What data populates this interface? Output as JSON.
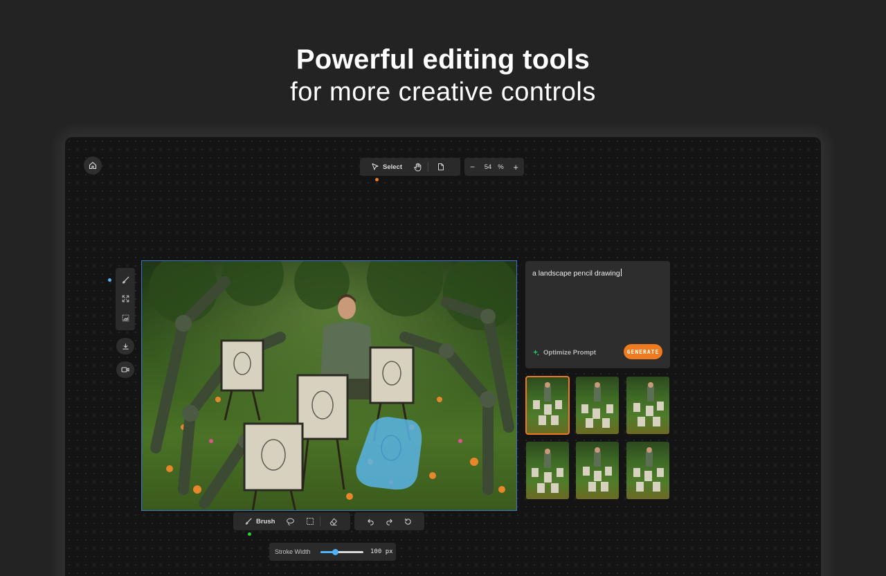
{
  "hero": {
    "title": "Powerful editing tools",
    "subtitle": "for more creative controls"
  },
  "top_toolbar": {
    "select_label": "Select",
    "icons": [
      "cursor-icon",
      "hand-icon",
      "page-icon"
    ]
  },
  "zoom": {
    "minus": "−",
    "value": "54",
    "unit": "%",
    "plus": "+"
  },
  "side_tools": [
    "brush-icon",
    "expand-icon",
    "image-edit-icon",
    "download-icon",
    "video-icon"
  ],
  "prompt": {
    "text": "a landscape pencil drawing",
    "optimize_label": "Optimize Prompt",
    "generate_label": "GENERATE"
  },
  "thumbnails": {
    "count": 6,
    "selected_index": 0
  },
  "bottom_toolbar": {
    "brush_label": "Brush",
    "icons": [
      "brush-icon",
      "lasso-icon",
      "marquee-icon",
      "eraser-icon",
      "undo-icon",
      "redo-icon",
      "reset-icon"
    ]
  },
  "stroke": {
    "label": "Stroke Width",
    "value": "100",
    "unit": "px",
    "fraction": 0.35
  },
  "colors": {
    "accent": "#f07a1e",
    "selection_border": "#3b6fd0",
    "mask": "#5ab4e6",
    "status_dot_blue": "#4fb3ff",
    "status_dot_green": "#22d33a"
  }
}
